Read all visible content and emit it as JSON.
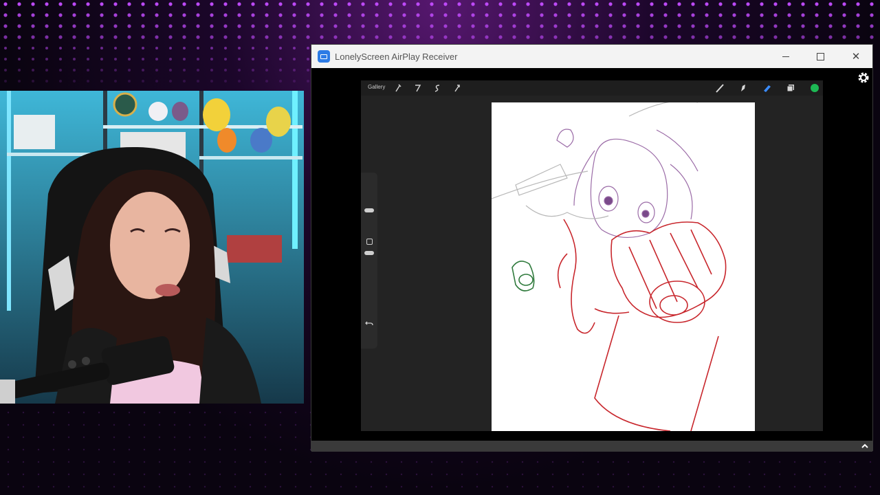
{
  "window": {
    "title": "LonelyScreen AirPlay Receiver",
    "minimize_icon": "minimize-icon",
    "maximize_icon": "maximize-icon",
    "close_label": "✕",
    "settings_icon": "gear-icon",
    "scroll_icon": "chevron-up-icon"
  },
  "procreate": {
    "gallery_label": "Gallery",
    "left_tools": [
      "wrench-icon",
      "magic-wand-icon",
      "selection-icon",
      "transform-icon"
    ],
    "right_tools": [
      "brush-icon",
      "smudge-icon",
      "eraser-icon",
      "layers-icon",
      "color-icon"
    ],
    "active_color": "#1db954",
    "eraser_active_color": "#3a8cff"
  },
  "colors": {
    "accent_purple": "#c34cff",
    "sketch_red": "#c8262c",
    "sketch_purple": "#8a5a9a",
    "sketch_green": "#2f7a3c"
  }
}
